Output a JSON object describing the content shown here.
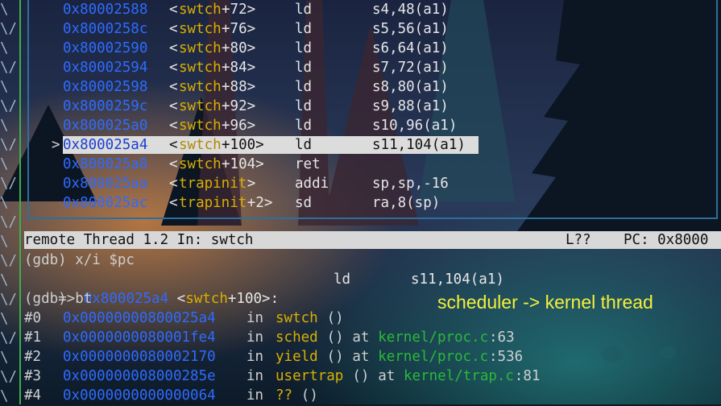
{
  "asm_lines": [
    {
      "addr": "0x80002588",
      "func": "swtch",
      "offset": "+72>",
      "instr": "ld",
      "args": "s4,48(a1)",
      "current": false
    },
    {
      "addr": "0x8000258c",
      "func": "swtch",
      "offset": "+76>",
      "instr": "ld",
      "args": "s5,56(a1)",
      "current": false
    },
    {
      "addr": "0x80002590",
      "func": "swtch",
      "offset": "+80>",
      "instr": "ld",
      "args": "s6,64(a1)",
      "current": false
    },
    {
      "addr": "0x80002594",
      "func": "swtch",
      "offset": "+84>",
      "instr": "ld",
      "args": "s7,72(a1)",
      "current": false
    },
    {
      "addr": "0x80002598",
      "func": "swtch",
      "offset": "+88>",
      "instr": "ld",
      "args": "s8,80(a1)",
      "current": false
    },
    {
      "addr": "0x8000259c",
      "func": "swtch",
      "offset": "+92>",
      "instr": "ld",
      "args": "s9,88(a1)",
      "current": false
    },
    {
      "addr": "0x800025a0",
      "func": "swtch",
      "offset": "+96>",
      "instr": "ld",
      "args": "s10,96(a1)",
      "current": false
    },
    {
      "addr": "0x800025a4",
      "func": "swtch",
      "offset": "+100>",
      "instr": "ld",
      "args": "s11,104(a1)",
      "current": true
    },
    {
      "addr": "0x800025a8",
      "func": "swtch",
      "offset": "+104>",
      "instr": "ret",
      "args": "",
      "current": false
    },
    {
      "addr": "0x800025aa",
      "func": "trapinit",
      "offset": ">",
      "instr": "addi",
      "args": "sp,sp,-16",
      "current": false
    },
    {
      "addr": "0x800025ac",
      "func": "trapinit",
      "offset": "+2>",
      "instr": "sd",
      "args": "ra,8(sp)",
      "current": false
    }
  ],
  "current_marker": ">",
  "margin_chars": [
    "\\",
    "\\/",
    "\\",
    "\\/",
    "\\",
    "\\/",
    "\\",
    "\\/",
    "\\",
    "\\/",
    "\\",
    "\\/",
    "\\",
    "\\/",
    "\\",
    "\\/",
    "\\",
    "\\/",
    "\\",
    "\\/",
    "\\"
  ],
  "status": {
    "left": "remote Thread 1.2 In: swtch",
    "line": "L??",
    "pc": "PC: 0x8000"
  },
  "console": {
    "cmd1": "(gdb) x/i $pc",
    "pc_arrow": "=> ",
    "pc_addr": "0x800025a4",
    "pc_func_open": " <",
    "pc_func": "swtch",
    "pc_func_off": "+100>:",
    "pc_instr": "ld",
    "pc_args": "s11,104(a1)",
    "cmd2": "(gdb) bt"
  },
  "backtrace": [
    {
      "num": "#0",
      "addr": "0x00000000800025a4",
      "in": "in",
      "func": "swtch",
      "args": "()",
      "at": "",
      "file": "",
      "line": ""
    },
    {
      "num": "#1",
      "addr": "0x0000000080001fe4",
      "in": "in",
      "func": "sched",
      "args": "()",
      "at": "at",
      "file": "kernel/proc.c",
      "line": ":63"
    },
    {
      "num": "#2",
      "addr": "0x0000000080002170",
      "in": "in",
      "func": "yield",
      "args": "()",
      "at": "at",
      "file": "kernel/proc.c",
      "line": ":536"
    },
    {
      "num": "#3",
      "addr": "0x000000008000285e",
      "in": "in",
      "func": "usertrap",
      "args": "()",
      "at": "at",
      "file": "kernel/trap.c",
      "line": ":81"
    },
    {
      "num": "#4",
      "addr": "0x0000000000000064",
      "in": "in",
      "func": "??",
      "args": "()",
      "at": "",
      "file": "",
      "line": ""
    }
  ],
  "annotation": "scheduler -> kernel thread",
  "colors": {
    "addr": "#2f6bff",
    "func": "#d9b000",
    "file": "#2cb83a",
    "annotation": "#f4f03a",
    "status_bg": "#d8d8d8"
  }
}
